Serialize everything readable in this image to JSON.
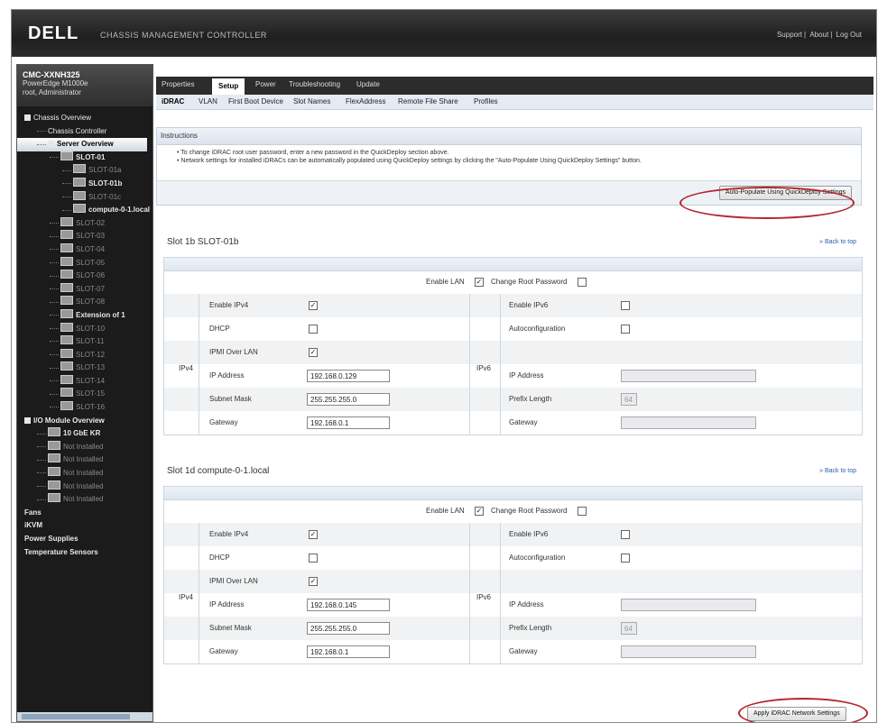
{
  "header": {
    "logo": "DELL",
    "app_title": "CHASSIS MANAGEMENT CONTROLLER",
    "links": [
      "Support",
      "About",
      "Log Out"
    ]
  },
  "sidebar": {
    "cmc_name": "CMC-XXNH325",
    "model": "PowerEdge M1000e",
    "role": "root, Administrator",
    "tree": [
      {
        "label": "Chassis Overview",
        "level": 0,
        "style": "normal",
        "icon": "box"
      },
      {
        "label": "Chassis Controller",
        "level": 1,
        "style": "normal",
        "icon": "none"
      },
      {
        "label": "Server Overview",
        "level": 1,
        "style": "selected",
        "icon": "box"
      },
      {
        "label": "SLOT-01",
        "level": 2,
        "style": "bold",
        "icon": "server"
      },
      {
        "label": "SLOT-01a",
        "level": 3,
        "style": "dim",
        "icon": "server"
      },
      {
        "label": "SLOT-01b",
        "level": 3,
        "style": "bold",
        "icon": "server"
      },
      {
        "label": "SLOT-01c",
        "level": 3,
        "style": "dim",
        "icon": "server"
      },
      {
        "label": "compute-0-1.local",
        "level": 3,
        "style": "bold",
        "icon": "server"
      },
      {
        "label": "SLOT-02",
        "level": 2,
        "style": "dim",
        "icon": "server"
      },
      {
        "label": "SLOT-03",
        "level": 2,
        "style": "dim",
        "icon": "server"
      },
      {
        "label": "SLOT-04",
        "level": 2,
        "style": "dim",
        "icon": "server"
      },
      {
        "label": "SLOT-05",
        "level": 2,
        "style": "dim",
        "icon": "server"
      },
      {
        "label": "SLOT-06",
        "level": 2,
        "style": "dim",
        "icon": "server"
      },
      {
        "label": "SLOT-07",
        "level": 2,
        "style": "dim",
        "icon": "server"
      },
      {
        "label": "SLOT-08",
        "level": 2,
        "style": "dim",
        "icon": "server"
      },
      {
        "label": "Extension of 1",
        "level": 2,
        "style": "bold",
        "icon": "server"
      },
      {
        "label": "SLOT-10",
        "level": 2,
        "style": "dim",
        "icon": "server"
      },
      {
        "label": "SLOT-11",
        "level": 2,
        "style": "dim",
        "icon": "server"
      },
      {
        "label": "SLOT-12",
        "level": 2,
        "style": "dim",
        "icon": "server"
      },
      {
        "label": "SLOT-13",
        "level": 2,
        "style": "dim",
        "icon": "server"
      },
      {
        "label": "SLOT-14",
        "level": 2,
        "style": "dim",
        "icon": "server"
      },
      {
        "label": "SLOT-15",
        "level": 2,
        "style": "dim",
        "icon": "server"
      },
      {
        "label": "SLOT-16",
        "level": 2,
        "style": "dim",
        "icon": "server"
      },
      {
        "label": "I/O Module Overview",
        "level": 0,
        "style": "bold",
        "icon": "box"
      },
      {
        "label": "10 GbE KR",
        "level": 1,
        "style": "bold",
        "icon": "server"
      },
      {
        "label": "Not Installed",
        "level": 1,
        "style": "dim",
        "icon": "server"
      },
      {
        "label": "Not Installed",
        "level": 1,
        "style": "dim",
        "icon": "server"
      },
      {
        "label": "Not Installed",
        "level": 1,
        "style": "dim",
        "icon": "server"
      },
      {
        "label": "Not Installed",
        "level": 1,
        "style": "dim",
        "icon": "server"
      },
      {
        "label": "Not Installed",
        "level": 1,
        "style": "dim",
        "icon": "server"
      },
      {
        "label": "Fans",
        "level": 0,
        "style": "bold",
        "icon": "none"
      },
      {
        "label": "iKVM",
        "level": 0,
        "style": "bold",
        "icon": "none"
      },
      {
        "label": "Power Supplies",
        "level": 0,
        "style": "bold",
        "icon": "none"
      },
      {
        "label": "Temperature Sensors",
        "level": 0,
        "style": "bold",
        "icon": "none"
      }
    ]
  },
  "tabs": [
    "Properties",
    "Setup",
    "Power",
    "Troubleshooting",
    "Update"
  ],
  "active_tab": "Setup",
  "subtabs": [
    "iDRAC",
    "VLAN",
    "First Boot Device",
    "Slot Names",
    "FlexAddress",
    "Remote File Share",
    "Profiles"
  ],
  "active_subtab": "iDRAC",
  "instructions": {
    "title": "Instructions",
    "lines": [
      "To change iDRAC root user password, enter a new password in the QuickDeploy section above.",
      "Network settings for installed iDRACs can be automatically populated using QuickDeploy settings by clicking the \"Auto-Populate Using QuickDeploy Settings\" button."
    ],
    "auto_button": "Auto-Populate Using QuickDeploy Settings"
  },
  "labels": {
    "enable_lan": "Enable LAN",
    "change_root_pw": "Change Root Password",
    "back_to_top": "» Back to top",
    "ipv4": "IPv4",
    "ipv6": "IPv6",
    "enable_ipv4": "Enable IPv4",
    "dhcp": "DHCP",
    "ipmi": "IPMI Over LAN",
    "ip_address": "IP Address",
    "subnet_mask": "Subnet Mask",
    "gateway": "Gateway",
    "enable_ipv6": "Enable IPv6",
    "autoconfig": "Autoconfiguration",
    "prefix_length": "Prefix Length"
  },
  "slots": [
    {
      "title": "Slot  1b  SLOT-01b",
      "enable_lan": true,
      "change_root_pw": false,
      "ipv4_enabled": true,
      "dhcp": false,
      "ipmi": true,
      "ip": "192.168.0.129",
      "mask": "255.255.255.0",
      "gateway": "192.168.0.1",
      "ipv6_enabled": false,
      "autoconfig": false,
      "ipv6_address": "",
      "prefix": "64",
      "ipv6_gateway": ""
    },
    {
      "title": "Slot  1d  compute-0-1.local",
      "enable_lan": true,
      "change_root_pw": false,
      "ipv4_enabled": true,
      "dhcp": false,
      "ipmi": true,
      "ip": "192.168.0.145",
      "mask": "255.255.255.0",
      "gateway": "192.168.0.1",
      "ipv6_enabled": false,
      "autoconfig": false,
      "ipv6_address": "",
      "prefix": "64",
      "ipv6_gateway": ""
    }
  ],
  "apply_button": "Apply iDRAC Network Settings",
  "colors": {
    "highlight_oval": "#b3272d",
    "header_bg": "#2c2c2c",
    "subtab_bg": "#e4ebf2"
  }
}
